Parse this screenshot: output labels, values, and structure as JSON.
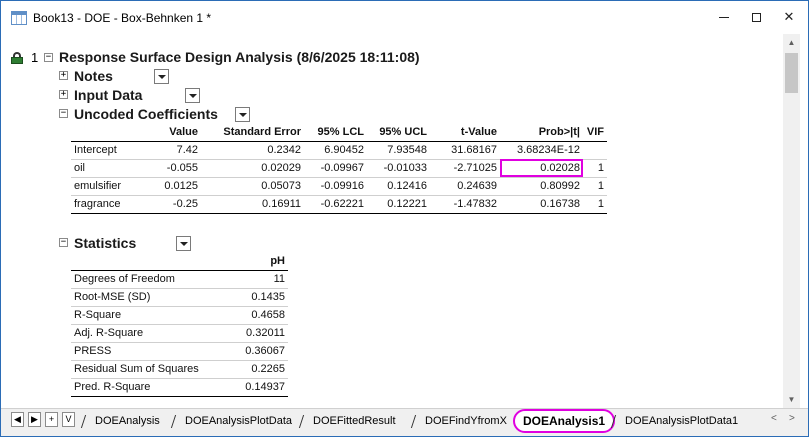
{
  "window": {
    "title": "Book13 - DOE - Box-Behnken 1 *",
    "icon": "workbook-icon",
    "minimize_icon": "minimize-icon",
    "maximize_icon": "maximize-icon",
    "close_symbol": "✕"
  },
  "report": {
    "node_number": "1",
    "title": "Response Surface Design Analysis (8/6/2025 18:11:08)",
    "sections": {
      "notes": "Notes",
      "input_data": "Input Data",
      "uncoded": "Uncoded Coefficients",
      "statistics": "Statistics"
    },
    "toggle_collapsed": "+",
    "toggle_expanded": "−"
  },
  "uncoded_table": {
    "headers": [
      "",
      "Value",
      "Standard Error",
      "95% LCL",
      "95% UCL",
      "t-Value",
      "Prob>|t|",
      "VIF"
    ],
    "rows": [
      [
        "Intercept",
        "7.42",
        "0.2342",
        "6.90452",
        "7.93548",
        "31.68167",
        "3.68234E-12",
        ""
      ],
      [
        "oil",
        "-0.055",
        "0.02029",
        "-0.09967",
        "-0.01033",
        "-2.71025",
        "0.02028",
        "1"
      ],
      [
        "emulsifier",
        "0.0125",
        "0.05073",
        "-0.09916",
        "0.12416",
        "0.24639",
        "0.80992",
        "1"
      ],
      [
        "fragrance",
        "-0.25",
        "0.16911",
        "-0.62221",
        "0.12221",
        "-1.47832",
        "0.16738",
        "1"
      ]
    ],
    "highlight_color": "#e000e0"
  },
  "statistics_table": {
    "header": "pH",
    "rows": [
      [
        "Degrees of Freedom",
        "11"
      ],
      [
        "Root-MSE (SD)",
        "0.1435"
      ],
      [
        "R-Square",
        "0.4658"
      ],
      [
        "Adj. R-Square",
        "0.32011"
      ],
      [
        "PRESS",
        "0.36067"
      ],
      [
        "Residual Sum of Squares",
        "0.2265"
      ],
      [
        "Pred. R-Square",
        "0.14937"
      ]
    ]
  },
  "tabs": {
    "nav": [
      "◀",
      "▶",
      "+",
      "V"
    ],
    "sheets": [
      "DOEAnalysis",
      "DOEAnalysisPlotData",
      "DOEFittedResult",
      "DOEFindYfromX",
      "DOEAnalysis1",
      "DOEAnalysisPlotData1"
    ],
    "active_index": 4,
    "scroll_left": "<",
    "scroll_right": ">"
  },
  "scrollbar": {
    "up": "▲",
    "down": "▼"
  }
}
